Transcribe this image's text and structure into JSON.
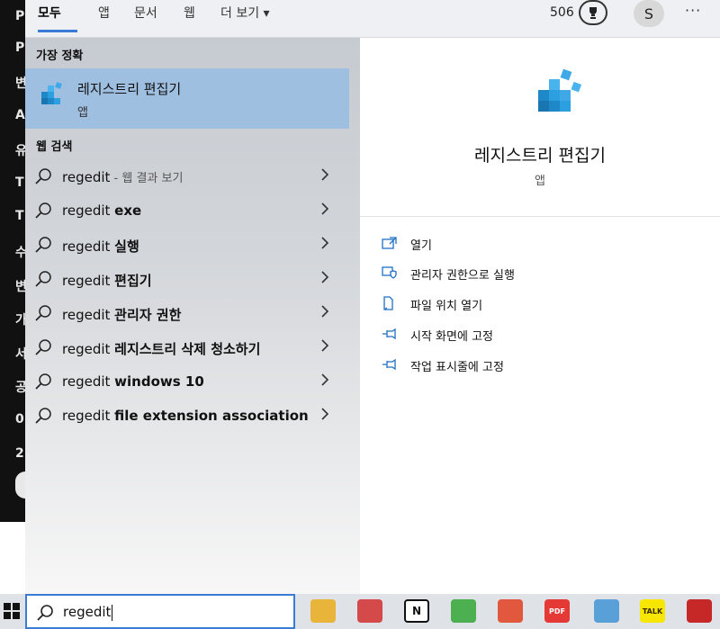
{
  "background": {
    "left_strip_chars": [
      "P",
      "P",
      "변",
      "A",
      "유",
      "T",
      "T",
      "수",
      "변",
      "가",
      "서",
      "공",
      "0",
      "2"
    ]
  },
  "tabs": [
    {
      "label": "모두",
      "active": true
    },
    {
      "label": "앱"
    },
    {
      "label": "문서"
    },
    {
      "label": "웹"
    },
    {
      "label": "더 보기 ▾"
    }
  ],
  "header": {
    "points": "506",
    "avatar_initial": "S",
    "more_label": "···"
  },
  "best_match": {
    "section_label": "가장 정확",
    "title": "레지스트리 편집기",
    "type": "앱",
    "icon": "registry-editor-icon"
  },
  "web_search": {
    "section_label": "웹 검색",
    "results": [
      {
        "prefix": "regedit",
        "bold": "",
        "hint": " - 웹 결과 보기"
      },
      {
        "prefix": "regedit ",
        "bold": "exe",
        "hint": ""
      },
      {
        "prefix": "regedit ",
        "bold": "실행",
        "hint": ""
      },
      {
        "prefix": "regedit ",
        "bold": "편집기",
        "hint": ""
      },
      {
        "prefix": "regedit ",
        "bold": "관리자 권한",
        "hint": ""
      },
      {
        "prefix": "regedit ",
        "bold": "레지스트리 삭제 청소하기",
        "hint": ""
      },
      {
        "prefix": "regedit ",
        "bold": "windows 10",
        "hint": ""
      },
      {
        "prefix": "regedit ",
        "bold": "file extension association",
        "hint": ""
      }
    ]
  },
  "detail": {
    "app_name": "레지스트리 편집기",
    "app_type": "앱",
    "actions": [
      {
        "label": "열기",
        "icon": "open-icon"
      },
      {
        "label": "관리자 권한으로 실행",
        "icon": "admin-shield-icon"
      },
      {
        "label": "파일 위치 열기",
        "icon": "file-location-icon"
      },
      {
        "label": "시작 화면에 고정",
        "icon": "pin-icon"
      },
      {
        "label": "작업 표시줄에 고정",
        "icon": "pin-icon"
      }
    ]
  },
  "taskbar": {
    "search_value": "regedit",
    "apps": [
      {
        "name": "file-explorer",
        "color": "#e8b53a"
      },
      {
        "name": "snipping-tool",
        "color": "#d44a4a"
      },
      {
        "name": "notion",
        "color": "#222222"
      },
      {
        "name": "green-app",
        "color": "#4caf50"
      },
      {
        "name": "red-app",
        "color": "#e2583e"
      },
      {
        "name": "pdf-app",
        "color": "#e53935"
      },
      {
        "name": "blue-note-app",
        "color": "#5aa0d8"
      },
      {
        "name": "kakaotalk",
        "color": "#f7e600"
      },
      {
        "name": "grid-app",
        "color": "#c62828"
      }
    ],
    "kakao_label": "TALK",
    "notion_label": "N",
    "pdf_label": "PDF"
  }
}
